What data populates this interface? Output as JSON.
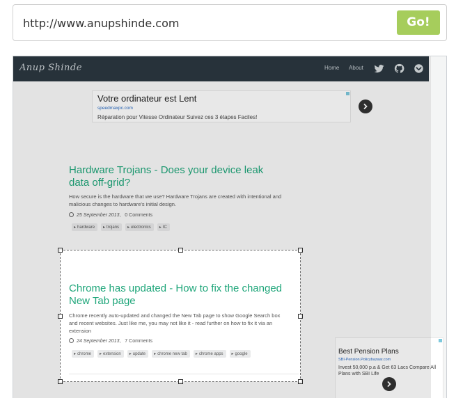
{
  "url_bar": {
    "value": "http://www.anupshinde.com",
    "go_label": "Go!"
  },
  "site": {
    "logo": "Anup Shinde",
    "nav": [
      {
        "label": "Home"
      },
      {
        "label": "About"
      }
    ],
    "nav_icons": [
      "twitter-icon",
      "github-icon",
      "chevron-down-circle-icon"
    ]
  },
  "ad_top": {
    "title": "Votre ordinateur est Lent",
    "domain": "speedmaxpc.com",
    "description": "Réparation pour Vitesse Ordinateur Suivez ces 3 étapes Faciles!"
  },
  "posts": [
    {
      "title": "Hardware Trojans - Does your device leak data off-grid?",
      "excerpt": "How secure is the hardware that we use? Hardware Trojans are created with intentional and malicious changes to hardware's initial design.",
      "date": "25 September 2013",
      "separator": ",",
      "comments": "0 Comments",
      "tags": [
        "hardware",
        "trojans",
        "electronics",
        "IC"
      ]
    },
    {
      "title": "Chrome has updated - How to fix the changed New Tab page",
      "excerpt": "Chrome recently auto-updated and changed the New Tab page to show Google Search box and recent websites. Just like me, you may not like it - read further on how to fix it via an extension",
      "date": "24 September 2013",
      "separator": ",",
      "comments": "7 Comments",
      "tags": [
        "chrome",
        "extension",
        "update",
        "chrome new tab",
        "chrome apps",
        "google"
      ]
    }
  ],
  "ad_side": {
    "title": "Best Pension Plans",
    "domain": "SBI-Pension.Policybazaar.com",
    "description": "Invest 50,000 p.a & Get 63 Lacs Compare All Plans with SBI Life"
  },
  "colors": {
    "accent_button": "#a6cd5c",
    "navbar": "#2b3840",
    "post_title": "#1fa67a"
  }
}
